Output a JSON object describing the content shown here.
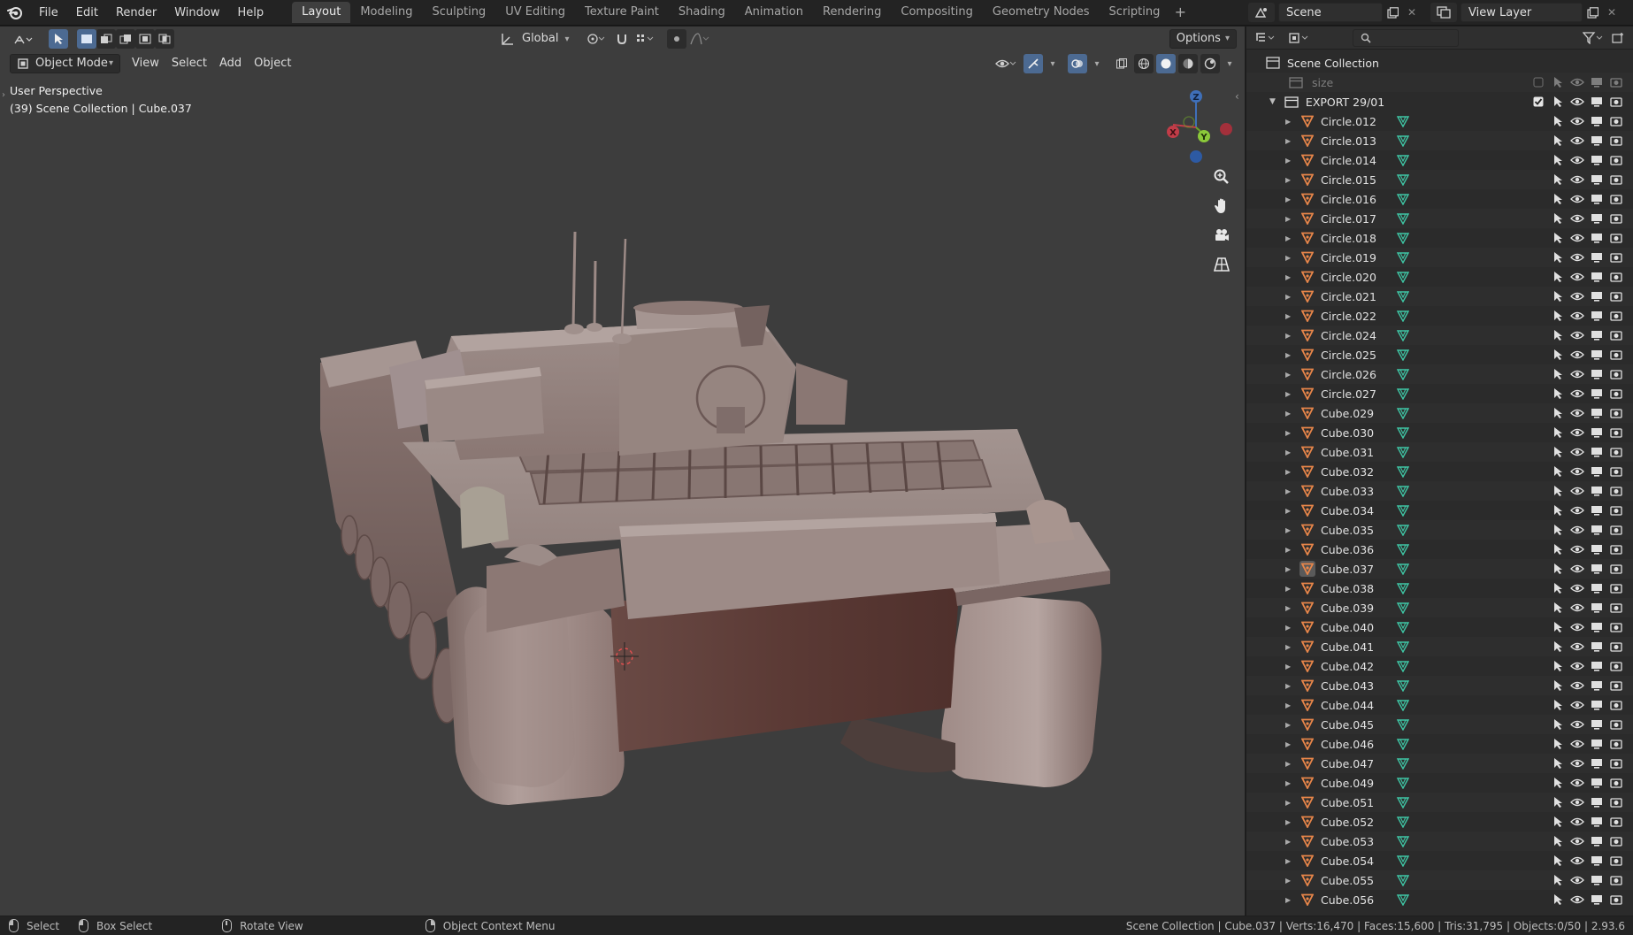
{
  "menu": {
    "items": [
      "File",
      "Edit",
      "Render",
      "Window",
      "Help"
    ]
  },
  "workspaces": {
    "tabs": [
      "Layout",
      "Modeling",
      "Sculpting",
      "UV Editing",
      "Texture Paint",
      "Shading",
      "Animation",
      "Rendering",
      "Compositing",
      "Geometry Nodes",
      "Scripting"
    ],
    "active": "Layout",
    "add": "+"
  },
  "scene": {
    "name": "Scene",
    "view_layer": "View Layer"
  },
  "viewport": {
    "transform_orientation": "Global",
    "options_label": "Options",
    "mode": "Object Mode",
    "menus": [
      "View",
      "Select",
      "Add",
      "Object"
    ],
    "perspective_label": "User Perspective",
    "context_label": "(39) Scene Collection | Cube.037",
    "gizmo": {
      "x": "X",
      "y": "Y",
      "z": "Z"
    }
  },
  "outliner": {
    "root": "Scene Collection",
    "size_collection": "size",
    "export_collection": "EXPORT 29/01",
    "selected": "Cube.037",
    "objects": [
      "Circle.012",
      "Circle.013",
      "Circle.014",
      "Circle.015",
      "Circle.016",
      "Circle.017",
      "Circle.018",
      "Circle.019",
      "Circle.020",
      "Circle.021",
      "Circle.022",
      "Circle.024",
      "Circle.025",
      "Circle.026",
      "Circle.027",
      "Cube.029",
      "Cube.030",
      "Cube.031",
      "Cube.032",
      "Cube.033",
      "Cube.034",
      "Cube.035",
      "Cube.036",
      "Cube.037",
      "Cube.038",
      "Cube.039",
      "Cube.040",
      "Cube.041",
      "Cube.042",
      "Cube.043",
      "Cube.044",
      "Cube.045",
      "Cube.046",
      "Cube.047",
      "Cube.049",
      "Cube.051",
      "Cube.052",
      "Cube.053",
      "Cube.054",
      "Cube.055",
      "Cube.056"
    ]
  },
  "statusbar": {
    "select": "Select",
    "box_select": "Box Select",
    "rotate_view": "Rotate View",
    "context_menu": "Object Context Menu",
    "stats": "Scene Collection | Cube.037 | Verts:16,470 | Faces:15,600 | Tris:31,795 | Objects:0/50 | 2.93.6"
  },
  "colors": {
    "accent": "#4772b3",
    "mesh_icon": "#e8864a",
    "data_icon": "#3fc6a5",
    "selected_row": "#334d80"
  }
}
